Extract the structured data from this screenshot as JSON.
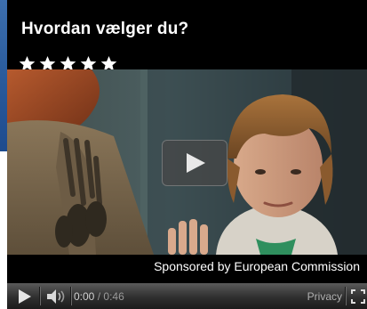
{
  "title": "Hvordan vælger du?",
  "rating": {
    "stars": 5,
    "max": 5
  },
  "sponsor": "Sponsored by European Commission",
  "controls": {
    "current_time": "0:00",
    "separator": "/",
    "duration": "0:46",
    "privacy_label": "Privacy"
  },
  "colors": {
    "background": "#000000",
    "text": "#ffffff",
    "controls": "#2f2f2f"
  },
  "icons": [
    "play-icon",
    "volume-icon",
    "fullscreen-icon",
    "star-icon"
  ]
}
